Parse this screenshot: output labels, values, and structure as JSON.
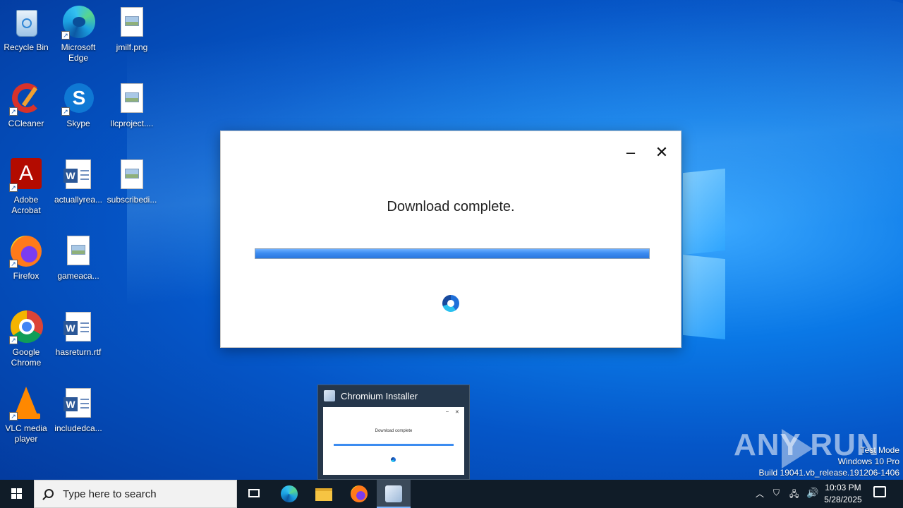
{
  "desktop": {
    "icons": [
      {
        "label": "Recycle Bin",
        "icon": "recycle-bin-icon"
      },
      {
        "label": "Microsoft Edge",
        "icon": "edge-icon"
      },
      {
        "label": "jmilf.png",
        "icon": "image-file-icon"
      },
      {
        "label": "CCleaner",
        "icon": "ccleaner-icon"
      },
      {
        "label": "Skype",
        "icon": "skype-icon"
      },
      {
        "label": "llcproject....",
        "icon": "image-file-icon"
      },
      {
        "label": "Adobe Acrobat",
        "icon": "acrobat-icon"
      },
      {
        "label": "actuallyrea...",
        "icon": "word-file-icon"
      },
      {
        "label": "subscribedi...",
        "icon": "image-file-icon"
      },
      {
        "label": "Firefox",
        "icon": "firefox-icon"
      },
      {
        "label": "gameaca...",
        "icon": "image-file-icon"
      },
      {
        "label": "Google Chrome",
        "icon": "chrome-icon"
      },
      {
        "label": "hasreturn.rtf",
        "icon": "word-file-icon"
      },
      {
        "label": "VLC media player",
        "icon": "vlc-icon"
      },
      {
        "label": "includedca...",
        "icon": "word-file-icon"
      }
    ]
  },
  "installer": {
    "status": "Download complete.",
    "progress": 1.0,
    "minimize": "–",
    "close": "✕"
  },
  "preview": {
    "title": "Chromium Installer",
    "thumb_status": "Download complete"
  },
  "watermark": {
    "brand": "ANY RUN",
    "line1": "Test Mode",
    "line2": "Windows 10 Pro",
    "line3": "Build 19041.vb_release.191206-1406"
  },
  "taskbar": {
    "search_placeholder": "Type here to search",
    "time": "10:03 PM",
    "date": "5/28/2025"
  }
}
